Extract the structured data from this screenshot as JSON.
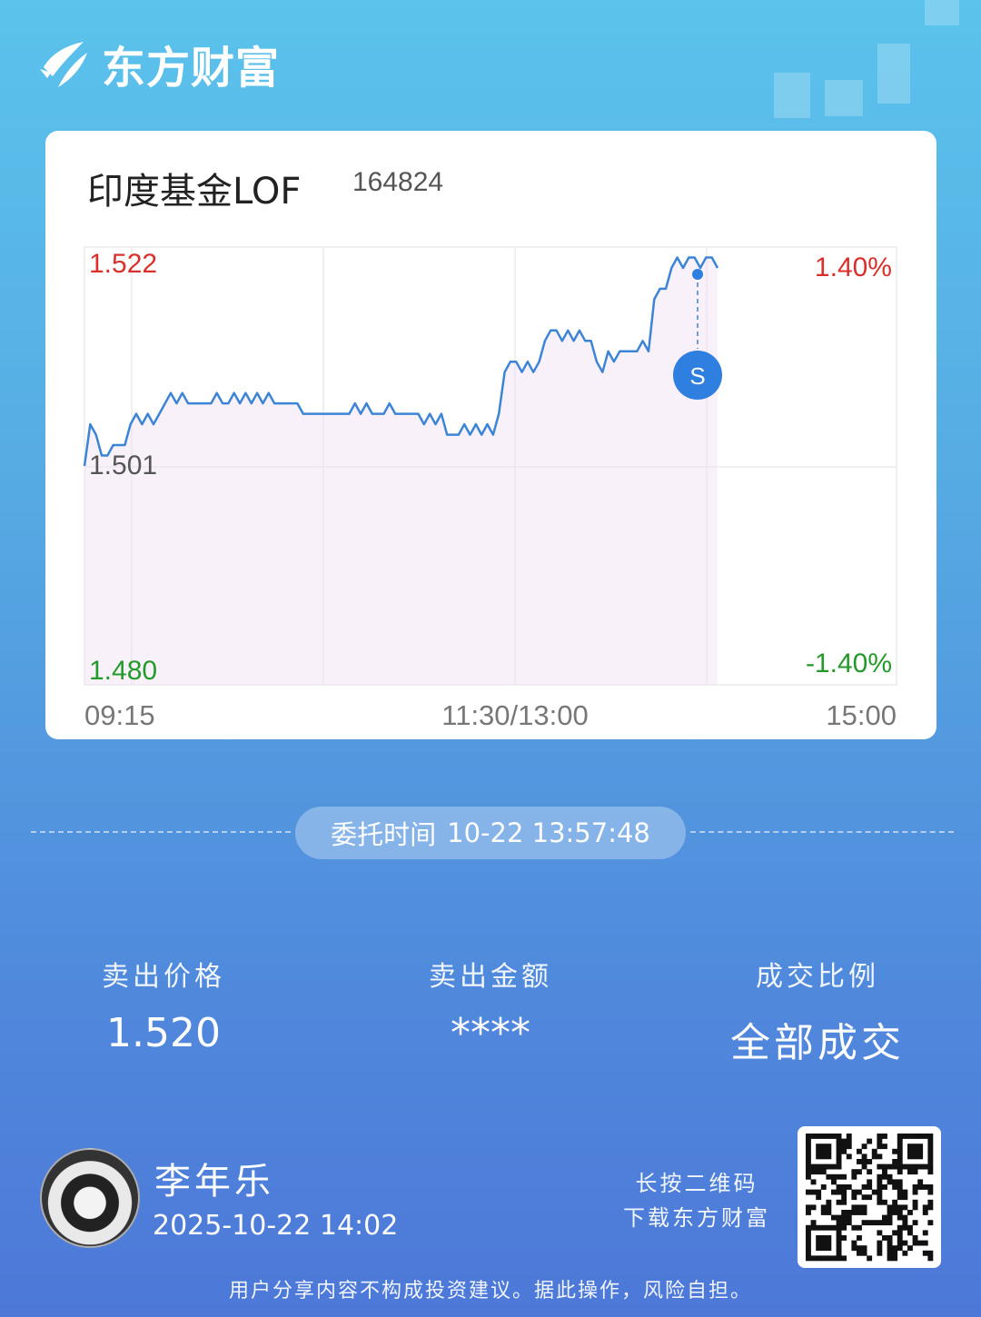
{
  "brand": {
    "name": "东方财富",
    "logo_icon": "eastmoney-logo-icon"
  },
  "fund": {
    "name": "印度基金LOF",
    "code": "164824"
  },
  "chart_data": {
    "type": "line",
    "title": "",
    "price_ticks": {
      "top": "1.522",
      "mid": "1.501",
      "bottom": "1.480"
    },
    "pct_ticks": {
      "top": "1.40%",
      "bottom": "-1.40%"
    },
    "time_labels": [
      "09:15",
      "11:30/13:00",
      "15:00"
    ],
    "ylim": [
      1.48,
      1.522
    ],
    "prev_close": 1.501,
    "series": [
      {
        "values": [
          1.501,
          1.505,
          1.504,
          1.502,
          1.502,
          1.503,
          1.503,
          1.503,
          1.505,
          1.506,
          1.505,
          1.506,
          1.505,
          1.506,
          1.507,
          1.508,
          1.507,
          1.508,
          1.507,
          1.507,
          1.507,
          1.507,
          1.507,
          1.508,
          1.507,
          1.507,
          1.508,
          1.507,
          1.508,
          1.507,
          1.508,
          1.507,
          1.508,
          1.507,
          1.507,
          1.507,
          1.507,
          1.507,
          1.506,
          1.506,
          1.506,
          1.506,
          1.506,
          1.506,
          1.506,
          1.506,
          1.506,
          1.507,
          1.506,
          1.507,
          1.506,
          1.506,
          1.506,
          1.507,
          1.506,
          1.506,
          1.506,
          1.506,
          1.506,
          1.505,
          1.506,
          1.505,
          1.506,
          1.504,
          1.504,
          1.504,
          1.505,
          1.504,
          1.505,
          1.504,
          1.505,
          1.504,
          1.506,
          1.51,
          1.511,
          1.511,
          1.51,
          1.511,
          1.51,
          1.511,
          1.513,
          1.514,
          1.514,
          1.513,
          1.514,
          1.513,
          1.514,
          1.513,
          1.513,
          1.511,
          1.51,
          1.512,
          1.511,
          1.512,
          1.512,
          1.512,
          1.512,
          1.513,
          1.512,
          1.517,
          1.518,
          1.518,
          1.52,
          1.521,
          1.52,
          1.521,
          1.521,
          1.52,
          1.521,
          1.521,
          1.52
        ]
      }
    ],
    "marker": {
      "label": "S",
      "time": "13:57",
      "price": 1.52
    }
  },
  "order": {
    "label": "委托时间",
    "datetime": "10-22 13:57:48"
  },
  "stats": [
    {
      "label": "卖出价格",
      "value": "1.520"
    },
    {
      "label": "卖出金额",
      "value": "****"
    },
    {
      "label": "成交比例",
      "value": "全部成交"
    }
  ],
  "user": {
    "name": "李年乐",
    "time": "2025-10-22 14:02"
  },
  "qr": {
    "line1": "长按二维码",
    "line2": "下载东方财富"
  },
  "disclaimer": "用户分享内容不构成投资建议。据此操作，风险自担。",
  "colors": {
    "up": "#d9302b",
    "down": "#239a2a",
    "line": "#3c84d6",
    "marker": "#2f7fe0"
  }
}
